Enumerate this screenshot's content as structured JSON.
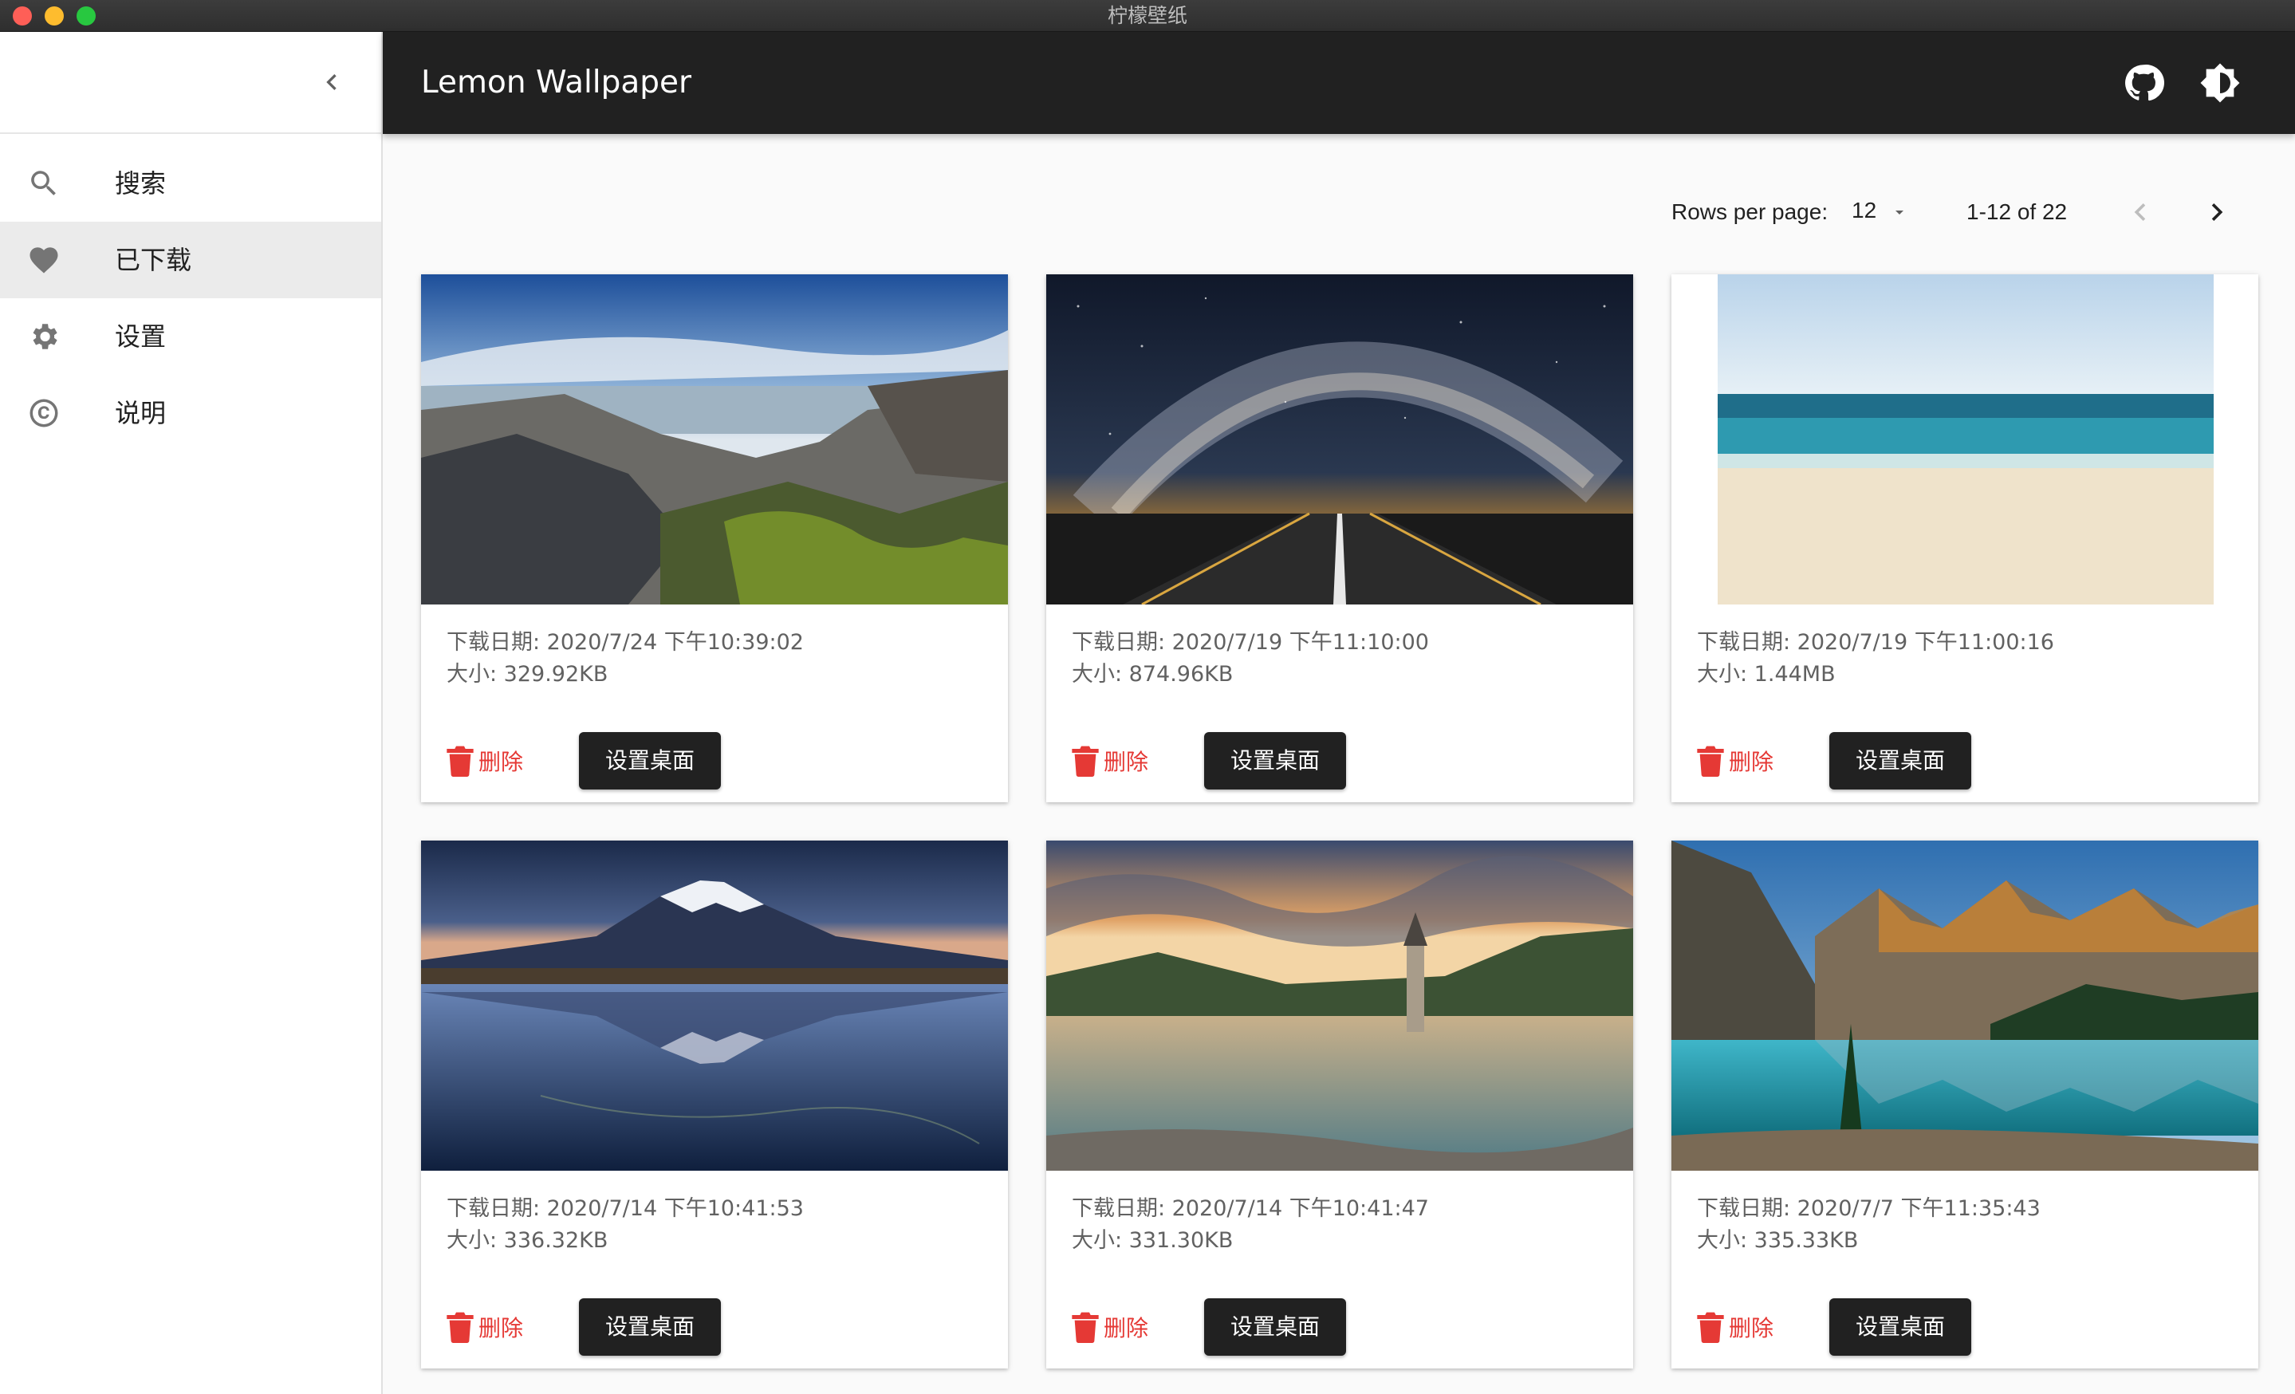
{
  "window": {
    "title": "柠檬壁纸"
  },
  "app": {
    "title": "Lemon Wallpaper"
  },
  "sidebar": {
    "items": [
      {
        "label": "搜索",
        "icon": "search-icon",
        "active": false
      },
      {
        "label": "已下载",
        "icon": "heart-icon",
        "active": true
      },
      {
        "label": "设置",
        "icon": "gear-icon",
        "active": false
      },
      {
        "label": "说明",
        "icon": "copyright-icon",
        "active": false
      }
    ]
  },
  "pagination": {
    "rows_per_page_label": "Rows per page:",
    "rows_per_page_value": "12",
    "range_text": "1-12 of 22"
  },
  "cards": [
    {
      "date": "下载日期: 2020/7/24 下午10:39:02",
      "size": "大小: 329.92KB",
      "delete_label": "删除",
      "set_label": "设置桌面",
      "scene": "basalt-coast"
    },
    {
      "date": "下载日期: 2020/7/19 下午11:10:00",
      "size": "大小: 874.96KB",
      "delete_label": "删除",
      "set_label": "设置桌面",
      "scene": "milky-way-road"
    },
    {
      "date": "下载日期: 2020/7/19 下午11:00:16",
      "size": "大小: 1.44MB",
      "delete_label": "删除",
      "set_label": "设置桌面",
      "scene": "beach-sea"
    },
    {
      "date": "下载日期: 2020/7/14 下午10:41:53",
      "size": "大小: 336.32KB",
      "delete_label": "删除",
      "set_label": "设置桌面",
      "scene": "snow-mountain-reflection"
    },
    {
      "date": "下载日期: 2020/7/14 下午10:41:47",
      "size": "大小: 331.30KB",
      "delete_label": "删除",
      "set_label": "设置桌面",
      "scene": "lake-tower"
    },
    {
      "date": "下载日期: 2020/7/7 下午11:35:43",
      "size": "大小: 335.33KB",
      "delete_label": "删除",
      "set_label": "设置桌面",
      "scene": "mountain-lake"
    }
  ],
  "colors": {
    "appbar": "#212121",
    "delete": "#e53935",
    "active_nav": "#ebebeb"
  }
}
